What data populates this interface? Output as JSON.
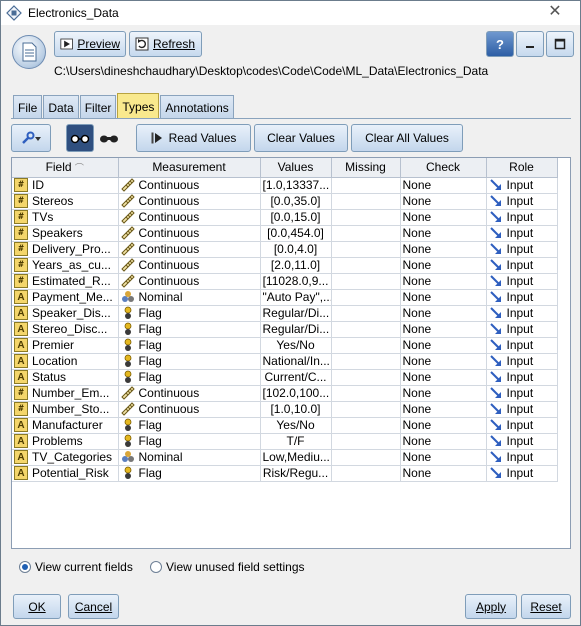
{
  "window": {
    "title": "Electronics_Data",
    "close_glyph": "✕"
  },
  "header": {
    "preview_label": "Preview",
    "refresh_label": "Refresh",
    "help_glyph": "?",
    "path": "C:\\Users\\dineshchaudhary\\Desktop\\codes\\Code\\Code\\ML_Data\\Electronics_Data"
  },
  "tabs": [
    {
      "label": "File"
    },
    {
      "label": "Data"
    },
    {
      "label": "Filter"
    },
    {
      "label": "Types"
    },
    {
      "label": "Annotations"
    }
  ],
  "toolbar": {
    "read_values_label": "Read Values",
    "clear_values_label": "Clear Values",
    "clear_all_values_label": "Clear All Values"
  },
  "table": {
    "columns": [
      "Field",
      "Measurement",
      "Values",
      "Missing",
      "Check",
      "Role"
    ],
    "rows": [
      {
        "field": "ID",
        "field_icon": "numeric",
        "measurement": "Continuous",
        "measure_icon": "ruler",
        "values": "[1.0,13337...",
        "missing": "",
        "check": "None",
        "role": "Input"
      },
      {
        "field": "Stereos",
        "field_icon": "numeric",
        "measurement": "Continuous",
        "measure_icon": "ruler",
        "values": "[0.0,35.0]",
        "missing": "",
        "check": "None",
        "role": "Input"
      },
      {
        "field": "TVs",
        "field_icon": "numeric",
        "measurement": "Continuous",
        "measure_icon": "ruler",
        "values": "[0.0,15.0]",
        "missing": "",
        "check": "None",
        "role": "Input"
      },
      {
        "field": "Speakers",
        "field_icon": "numeric",
        "measurement": "Continuous",
        "measure_icon": "ruler",
        "values": "[0.0,454.0]",
        "missing": "",
        "check": "None",
        "role": "Input"
      },
      {
        "field": "Delivery_Pro...",
        "field_icon": "numeric",
        "measurement": "Continuous",
        "measure_icon": "ruler",
        "values": "[0.0,4.0]",
        "missing": "",
        "check": "None",
        "role": "Input"
      },
      {
        "field": "Years_as_cu...",
        "field_icon": "numeric",
        "measurement": "Continuous",
        "measure_icon": "ruler",
        "values": "[2.0,11.0]",
        "missing": "",
        "check": "None",
        "role": "Input"
      },
      {
        "field": "Estimated_R...",
        "field_icon": "numeric",
        "measurement": "Continuous",
        "measure_icon": "ruler",
        "values": "[11028.0,9...",
        "missing": "",
        "check": "None",
        "role": "Input"
      },
      {
        "field": "Payment_Me...",
        "field_icon": "string",
        "measurement": "Nominal",
        "measure_icon": "nominal",
        "values": "\"Auto Pay\",...",
        "missing": "",
        "check": "None",
        "role": "Input"
      },
      {
        "field": "Speaker_Dis...",
        "field_icon": "string",
        "measurement": "Flag",
        "measure_icon": "flag",
        "values": "Regular/Di...",
        "missing": "",
        "check": "None",
        "role": "Input"
      },
      {
        "field": "Stereo_Disc...",
        "field_icon": "string",
        "measurement": "Flag",
        "measure_icon": "flag",
        "values": "Regular/Di...",
        "missing": "",
        "check": "None",
        "role": "Input"
      },
      {
        "field": "Premier",
        "field_icon": "string",
        "measurement": "Flag",
        "measure_icon": "flag",
        "values": "Yes/No",
        "missing": "",
        "check": "None",
        "role": "Input"
      },
      {
        "field": "Location",
        "field_icon": "string",
        "measurement": "Flag",
        "measure_icon": "flag",
        "values": "National/In...",
        "missing": "",
        "check": "None",
        "role": "Input"
      },
      {
        "field": "Status",
        "field_icon": "string",
        "measurement": "Flag",
        "measure_icon": "flag",
        "values": "Current/C...",
        "missing": "",
        "check": "None",
        "role": "Input"
      },
      {
        "field": "Number_Em...",
        "field_icon": "numeric",
        "measurement": "Continuous",
        "measure_icon": "ruler",
        "values": "[102.0,100...",
        "missing": "",
        "check": "None",
        "role": "Input"
      },
      {
        "field": "Number_Sto...",
        "field_icon": "numeric",
        "measurement": "Continuous",
        "measure_icon": "ruler",
        "values": "[1.0,10.0]",
        "missing": "",
        "check": "None",
        "role": "Input"
      },
      {
        "field": "Manufacturer",
        "field_icon": "string",
        "measurement": "Flag",
        "measure_icon": "flag",
        "values": "Yes/No",
        "missing": "",
        "check": "None",
        "role": "Input"
      },
      {
        "field": "Problems",
        "field_icon": "string",
        "measurement": "Flag",
        "measure_icon": "flag",
        "values": "T/F",
        "missing": "",
        "check": "None",
        "role": "Input"
      },
      {
        "field": "TV_Categories",
        "field_icon": "string",
        "measurement": "Nominal",
        "measure_icon": "nominal",
        "values": "Low,Mediu...",
        "missing": "",
        "check": "None",
        "role": "Input"
      },
      {
        "field": "Potential_Risk",
        "field_icon": "string",
        "measurement": "Flag",
        "measure_icon": "flag",
        "values": "Risk/Regu...",
        "missing": "",
        "check": "None",
        "role": "Input"
      }
    ]
  },
  "view_options": {
    "current_label": "View current fields",
    "unused_label": "View unused field settings",
    "selected": "current"
  },
  "buttons": {
    "ok": "OK",
    "cancel": "Cancel",
    "apply": "Apply",
    "reset": "Reset"
  }
}
